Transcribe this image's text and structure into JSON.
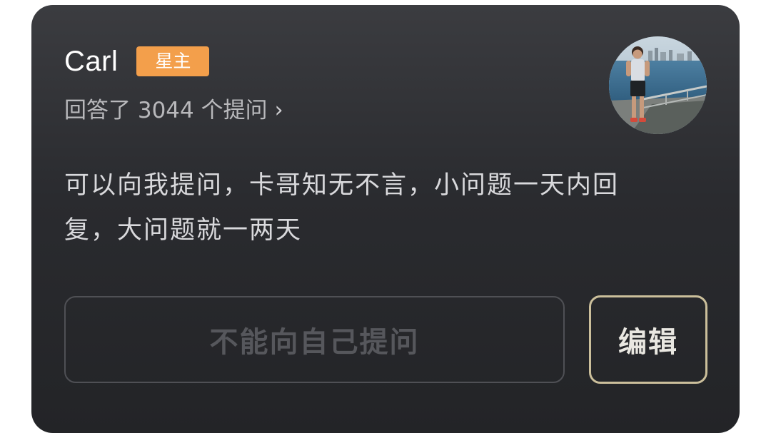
{
  "profile": {
    "name": "Carl",
    "badge": "星主",
    "answered_text": "回答了 3044 个提问",
    "chevron": "›",
    "avatar_icon": "person-photo-avatar"
  },
  "bio": "可以向我提问，卡哥知无不言，小问题一天内回复，大问题就一两天",
  "actions": {
    "ask_placeholder": "不能向自己提问",
    "edit_label": "编辑"
  },
  "colors": {
    "card_background": "#2b2c30",
    "badge": "#f39f4b",
    "edit_border": "#cbbf9b"
  }
}
